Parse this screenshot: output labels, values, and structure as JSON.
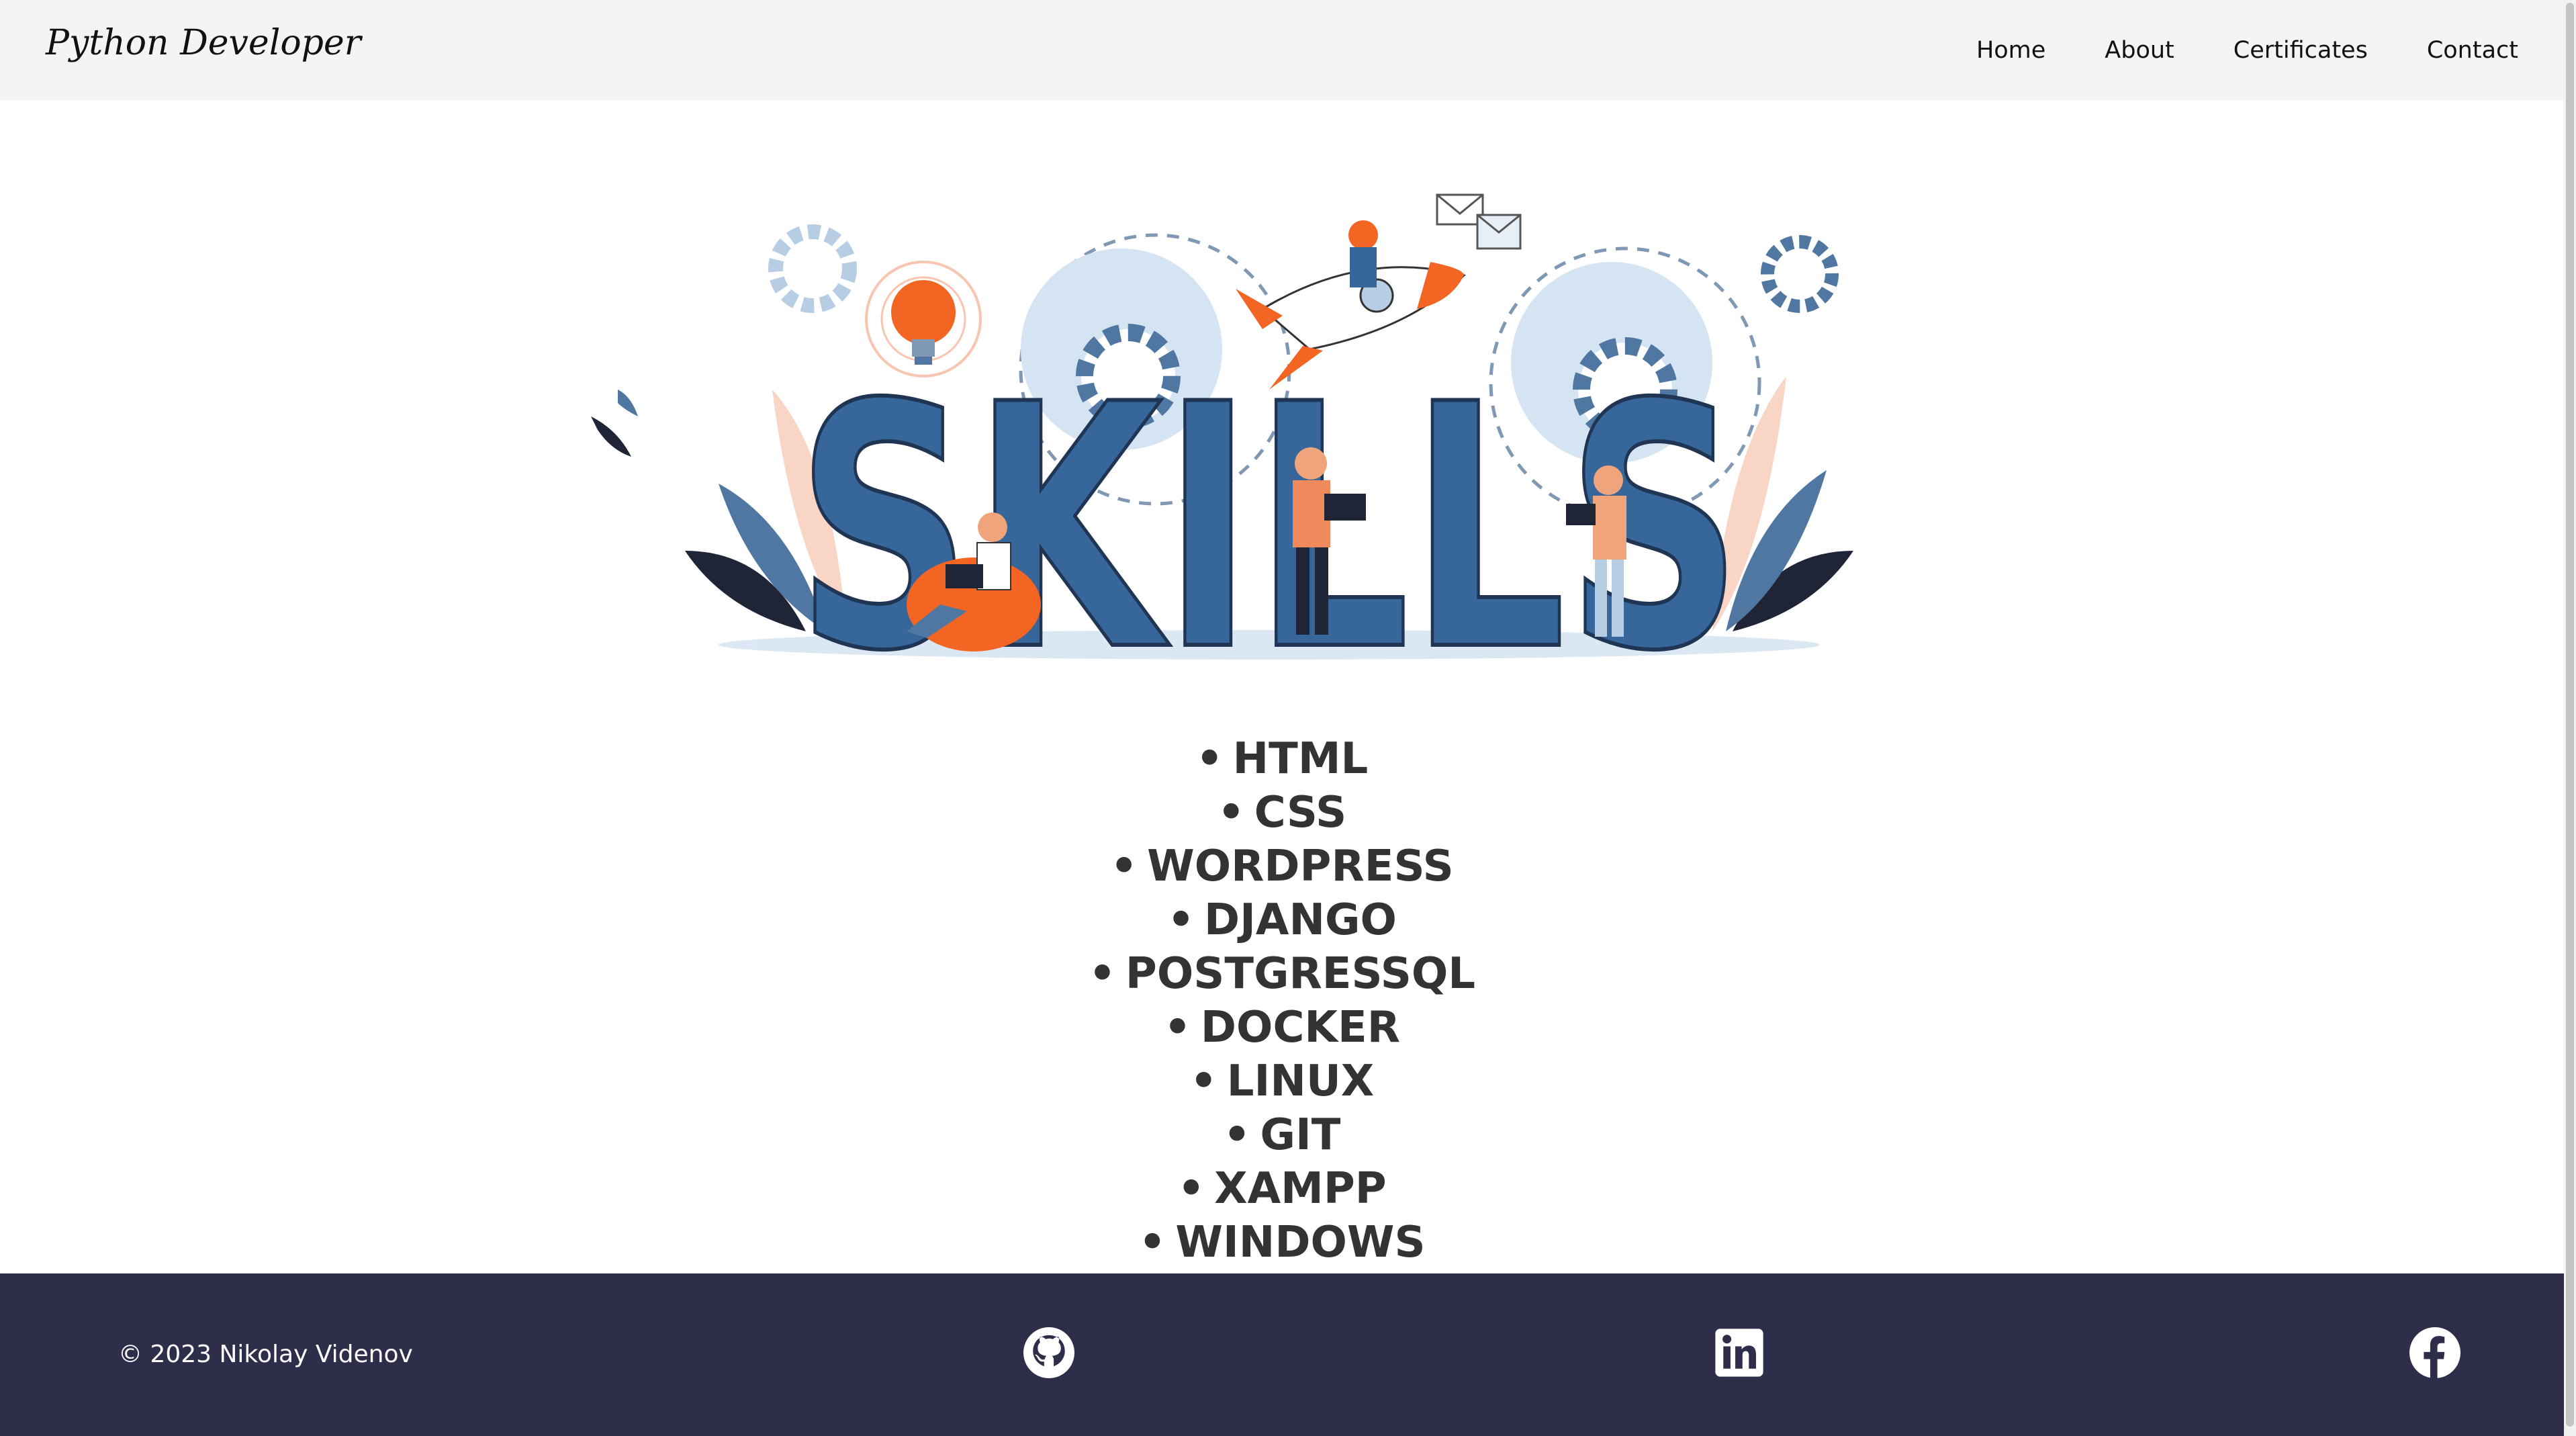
{
  "header": {
    "brand": "Python Developer",
    "nav": [
      "Home",
      "About",
      "Certificates",
      "Contact"
    ]
  },
  "hero": {
    "word": "SKILLS"
  },
  "skills": {
    "bullet": "•",
    "items": [
      "HTML",
      "CSS",
      "WORDPRESS",
      "DJANGO",
      "POSTGRESSQL",
      "DOCKER",
      "LINUX",
      "GIT",
      "XAMPP",
      "WINDOWS"
    ]
  },
  "footer": {
    "copyright": "© 2023 Nikolay Videnov",
    "icons": [
      "github-icon",
      "linkedin-icon",
      "facebook-icon"
    ]
  },
  "colors": {
    "header_bg": "#f4f4f4",
    "footer_bg": "#2e2e4a",
    "skills_text": "#333333",
    "hero_blue": "#37679a",
    "hero_orange": "#f26522"
  }
}
